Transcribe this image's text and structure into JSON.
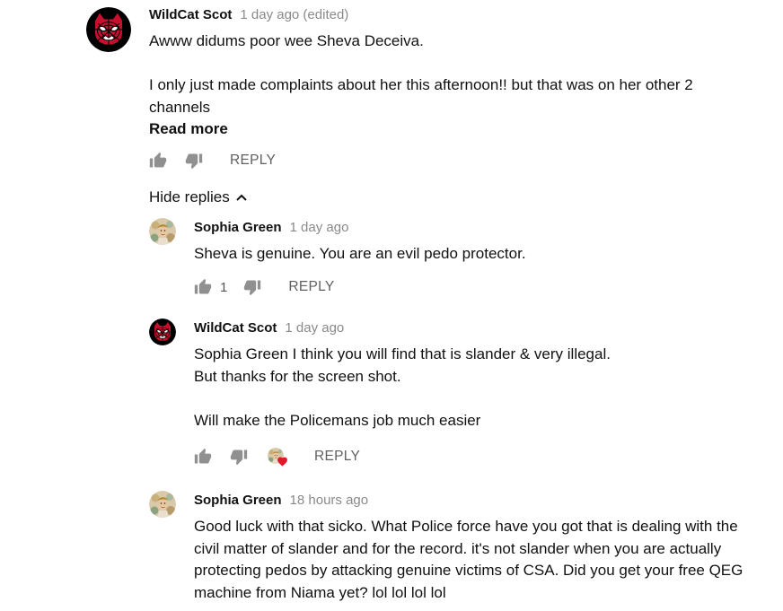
{
  "comments": [
    {
      "author": "WildCat Scot",
      "time": "1 day ago (edited)",
      "avatar_icon": "spider-cat-avatar-icon",
      "lines": [
        "Awww didums poor wee Sheva Deceiva.",
        "",
        "I only just made complaints about her this afternoon!! but that was on her other 2",
        "channels"
      ],
      "read_more": "Read more",
      "reply_label": "REPLY"
    }
  ],
  "hide_replies_label": "Hide replies",
  "replies": [
    {
      "author": "Sophia Green",
      "time": "1 day ago",
      "avatar_icon": "floral-portrait-avatar-icon",
      "lines": [
        "Sheva is genuine. You are an evil pedo protector."
      ],
      "like_count": "1",
      "reply_label": "REPLY"
    },
    {
      "author": "WildCat Scot",
      "time": "1 day ago",
      "avatar_icon": "spider-cat-avatar-icon",
      "lines": [
        "Sophia Green I think you will find that is slander & very illegal.",
        "But thanks for the screen shot.",
        "",
        "Will make the Policemans job much easier"
      ],
      "creator_heart": true,
      "reply_label": "REPLY"
    },
    {
      "author": "Sophia Green",
      "time": "18 hours ago",
      "avatar_icon": "floral-portrait-avatar-icon",
      "lines": [
        "Good luck with that sicko. What Police force have you got that is dealing with the",
        "civil matter of slander and for the record. it's not slander when you are actually",
        "protecting pedos by attacking genuine victims of CSA. Did you get your free QEG",
        "machine from Niama yet? lol lol lol lol"
      ]
    }
  ],
  "colors": {
    "heart": "#e0182b",
    "muted_text": "#8a8a8a",
    "icon_gray": "#909090"
  }
}
